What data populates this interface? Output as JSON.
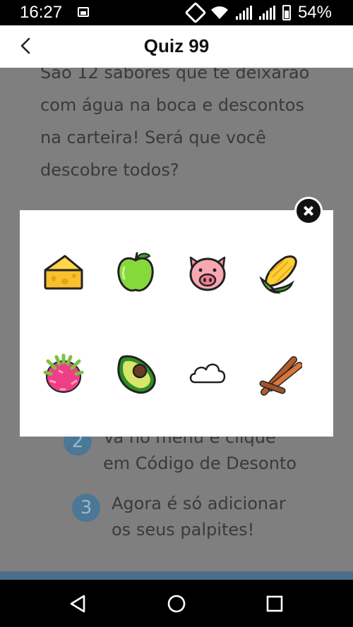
{
  "status_bar": {
    "time": "16:27",
    "battery": "54%"
  },
  "header": {
    "title": "Quiz 99",
    "back_icon": "chevron-left-icon"
  },
  "content": {
    "intro_text": "São 12 sabores que te deixarão com água na boca e descontos na carteira! Será que você descobre todos?",
    "steps": [
      {
        "number": "2",
        "text": "Vá no menu e clique em Código de Desonto"
      },
      {
        "number": "3",
        "text": "Agora é só adicionar os seus palpites!"
      }
    ]
  },
  "modal": {
    "close_icon": "close-icon",
    "emojis": [
      {
        "name": "cheese"
      },
      {
        "name": "green-apple"
      },
      {
        "name": "pig-face"
      },
      {
        "name": "corn"
      },
      {
        "name": "dragon-fruit"
      },
      {
        "name": "avocado"
      },
      {
        "name": "cloud"
      },
      {
        "name": "cinnamon"
      }
    ]
  },
  "nav_bar": {
    "icons": [
      "back-triangle-icon",
      "home-circle-icon",
      "recents-square-icon"
    ]
  }
}
